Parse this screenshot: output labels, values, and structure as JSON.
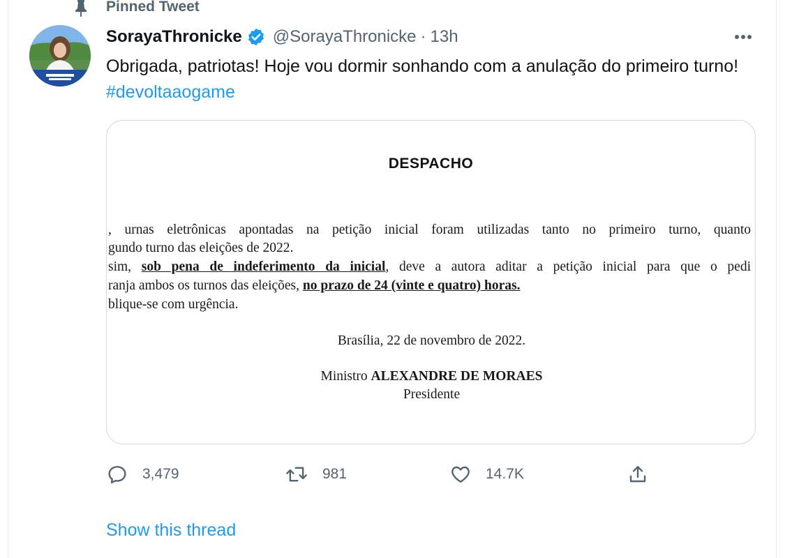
{
  "pinned": {
    "label": "Pinned Tweet",
    "icon": "pin-icon"
  },
  "tweet": {
    "display_name": "SorayaThronicke",
    "handle": "@SorayaThronicke",
    "separator": "·",
    "time": "13h",
    "text": "Obrigada, patriotas! Hoje vou dormir sonhando com a anulação do primeiro turno!",
    "hashtag": "#devoltaaogame"
  },
  "document": {
    "title": "DESPACHO",
    "line1": ", urnas eletrônicas apontadas na petição inicial foram utilizadas tanto no primeiro turno, quanto",
    "line2": "gundo turno das eleições de 2022.",
    "line3_pre": "sim,",
    "line3_underlined": "sob pena de indeferimento da inicial",
    "line3_post": ", deve a autora aditar a petição inicial para que o pedi",
    "line4_pre": "ranja ambos os turnos das eleições,",
    "line4_underlined": "no prazo de 24 (vinte e quatro) horas.",
    "line5": "blique-se com urgência.",
    "place_date": "Brasília, 22 de novembro de 2022.",
    "signer_prefix": "Ministro",
    "signer_name": "ALEXANDRE DE MORAES",
    "signer_role": "Presidente"
  },
  "actions": {
    "replies": "3,479",
    "retweets": "981",
    "likes": "14.7K"
  },
  "show_thread": "Show this thread",
  "colors": {
    "accent": "#1d9bf0",
    "secondary_text": "#536471",
    "primary_text": "#0f1419",
    "border": "#cfd9de"
  }
}
